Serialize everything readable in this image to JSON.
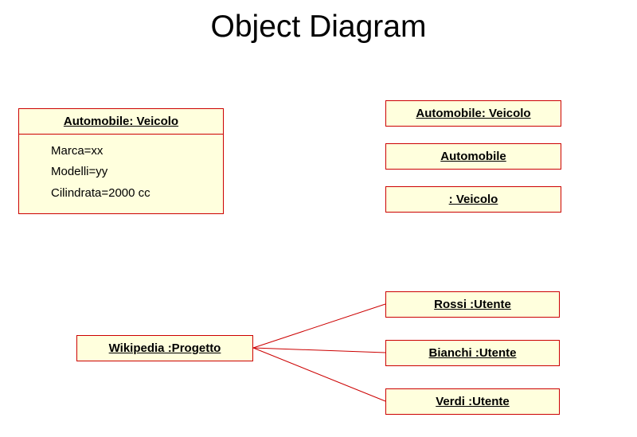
{
  "title": "Object Diagram",
  "main_object": {
    "header": "Automobile: Veicolo",
    "attrs": {
      "line1": "Marca=xx",
      "line2": "Modelli=yy",
      "line3": "Cilindrata=2000 cc"
    }
  },
  "right_boxes": {
    "b1": "Automobile: Veicolo",
    "b2": "Automobile",
    "b3": ": Veicolo"
  },
  "project": {
    "header": "Wikipedia :Progetto"
  },
  "users": {
    "u1": "Rossi :Utente",
    "u2": "Bianchi :Utente",
    "u3": "Verdi :Utente"
  },
  "colors": {
    "box_fill": "#FFFFDD",
    "box_border": "#CC0000",
    "text": "#000000"
  }
}
